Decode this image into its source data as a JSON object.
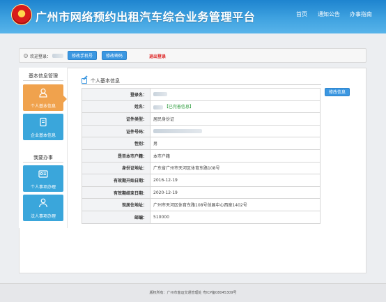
{
  "header": {
    "site_title": "广州市网络预约出租汽车综合业务管理平台",
    "nav": [
      "首页",
      "通知公告",
      "办事指南"
    ]
  },
  "user_bar": {
    "welcome": "欢迎登录：",
    "change_phone": "修改手机号",
    "change_password": "修改密码",
    "logout": "退出登录"
  },
  "sidebar": {
    "section1_title": "基本信息管理",
    "section2_title": "我要办事",
    "tiles": [
      {
        "label": "个人基本信息",
        "icon": "user-icon"
      },
      {
        "label": "企业基本信息",
        "icon": "document-icon"
      },
      {
        "label": "个人事项办理",
        "icon": "id-card-icon"
      },
      {
        "label": "法人事项办理",
        "icon": "person-icon"
      }
    ]
  },
  "panel": {
    "title": "个人基本信息",
    "edit_button": "修改信息",
    "rows": [
      {
        "key": "登录名：",
        "value": ""
      },
      {
        "key": "姓名：",
        "value": "",
        "badge": "【已完善信息】"
      },
      {
        "key": "证件类型：",
        "value": "居民身份证"
      },
      {
        "key": "证件号码：",
        "value": ""
      },
      {
        "key": "性别：",
        "value": "男"
      },
      {
        "key": "是否本市户籍：",
        "value": "本市户籍"
      },
      {
        "key": "身份证地址：",
        "value": "广东省广州市天河区体育东路108号"
      },
      {
        "key": "有效期开始日期：",
        "value": "2016-12-19"
      },
      {
        "key": "有效期结束日期：",
        "value": "2020-12-19"
      },
      {
        "key": "现居住地址：",
        "value": "广州市天河区体育东路108号创展中心西座1402号"
      },
      {
        "key": "邮编：",
        "value": "510000"
      }
    ]
  },
  "footer": {
    "text": "版权所有：广州市客运交通管理处 粤ICP备08045309号"
  },
  "colors": {
    "header_blue": "#3fa2e0",
    "button_blue": "#3b97e1",
    "tile_orange": "#f0a24d",
    "tile_blue": "#3aa6db",
    "logout_red": "#dd2222",
    "badge_green": "#2a9a3a"
  }
}
